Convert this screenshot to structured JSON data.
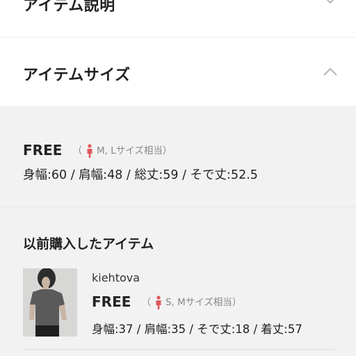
{
  "sections": {
    "description": {
      "title": "アイテム説明",
      "state_icon": "chevron-down-icon"
    },
    "size": {
      "title": "アイテムサイズ",
      "state_icon": "chevron-up-icon"
    }
  },
  "size_info": {
    "size": "FREE",
    "note_open": "（",
    "note": "M, Lサイズ相当）",
    "model_icon": "person-icon",
    "model_icon_color": "#e0585a",
    "dims": "身幅:60 / 肩幅:48 / 総丈:59 / そで丈:52.5"
  },
  "previous_purchase": {
    "title": "以前購入したアイテム",
    "item": {
      "brand": "kiehtova",
      "size": "FREE",
      "note_open": "（",
      "note": "S, Mサイズ相当）",
      "dims": "身幅:37 / 肩幅:35 / そで丈:18 / 着丈:57",
      "thumbnail": "model-photo"
    }
  },
  "colors": {
    "panel_bg": "#f2f2f2",
    "chevron": "#b5b5b5"
  }
}
